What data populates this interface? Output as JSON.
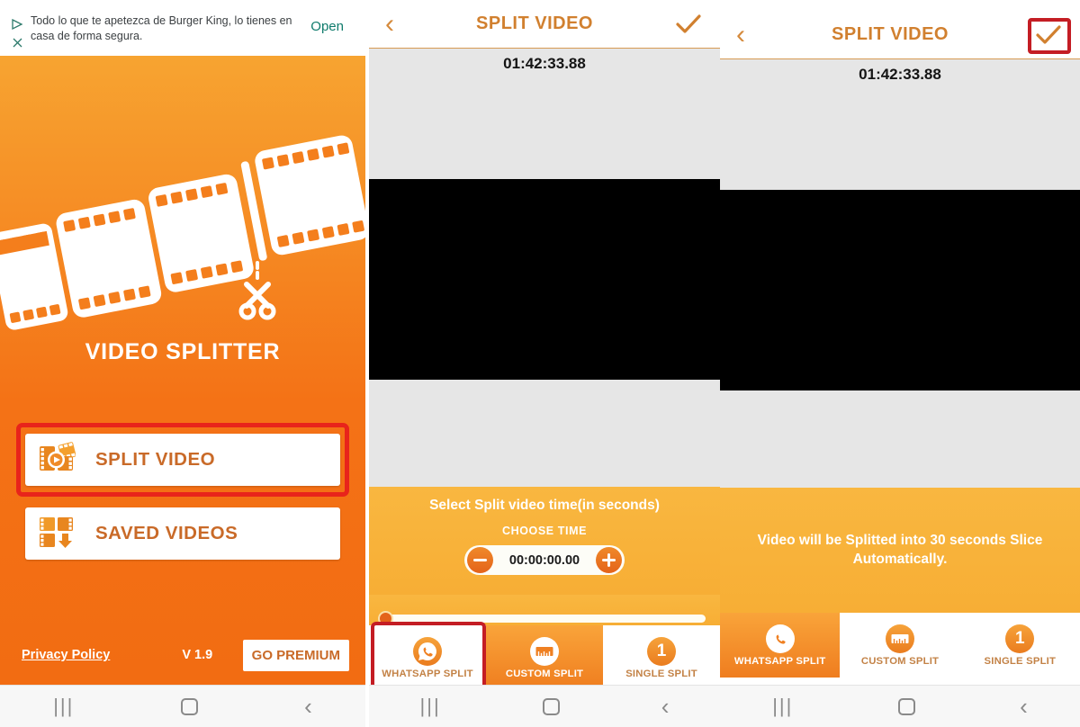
{
  "colors": {
    "orange_primary": "#f47216",
    "orange_light": "#f9b740",
    "orange_text": "#c96a28",
    "highlight_red": "#e8241b",
    "highlight_red_dark": "#c41d24",
    "white": "#ffffff",
    "video_bg": "#e6e6e6",
    "video_black": "#000000"
  },
  "screen1": {
    "ad": {
      "text": "Todo lo que te apetezca de Burger King, lo tienes en casa de forma segura.",
      "cta": "Open",
      "play_icon": "ad-choices-icon",
      "close_icon": "close-icon"
    },
    "logo_icon": "film-strip-scissors-logo",
    "app_title": "VIDEO SPLITTER",
    "buttons": [
      {
        "label": "SPLIT VIDEO",
        "icon": "film-play-icon",
        "highlighted": true
      },
      {
        "label": "SAVED VIDEOS",
        "icon": "film-download-icon",
        "highlighted": false
      }
    ],
    "footer": {
      "privacy": "Privacy Policy",
      "version": "V 1.9",
      "premium": "GO PREMIUM"
    }
  },
  "screen2": {
    "header": {
      "back_icon": "chevron-left-icon",
      "title": "SPLIT VIDEO",
      "confirm_icon": "check-icon",
      "confirm_highlighted": false
    },
    "timecode": "01:42:33.88",
    "controls": {
      "title": "Select Split video time(in seconds)",
      "subtitle": "CHOOSE TIME",
      "time_value": "00:00:00.00",
      "minus_icon": "minus-circle-icon",
      "plus_icon": "plus-circle-icon",
      "slider_value": 0
    },
    "tabs": [
      {
        "label": "WHATSAPP SPLIT",
        "icon": "whatsapp-icon",
        "state": "white",
        "highlighted": true
      },
      {
        "label": "CUSTOM SPLIT",
        "icon": "ruler-icon",
        "state": "orange",
        "highlighted": false
      },
      {
        "label": "SINGLE SPLIT",
        "icon": "number-one-icon",
        "state": "white",
        "highlighted": false
      }
    ]
  },
  "screen3": {
    "header": {
      "back_icon": "chevron-left-icon",
      "title": "SPLIT VIDEO",
      "confirm_icon": "check-icon",
      "confirm_highlighted": true
    },
    "timecode": "01:42:33.88",
    "message": "Video will be Splitted into 30 seconds Slice Automatically.",
    "tabs": [
      {
        "label": "WHATSAPP SPLIT",
        "icon": "whatsapp-icon",
        "state": "orange",
        "highlighted": false
      },
      {
        "label": "CUSTOM SPLIT",
        "icon": "ruler-icon",
        "state": "white",
        "highlighted": false
      },
      {
        "label": "SINGLE SPLIT",
        "icon": "number-one-icon",
        "state": "white",
        "highlighted": false
      }
    ]
  },
  "navbar": {
    "recents_icon": "recents-icon",
    "recents_glyph": "|||",
    "home_icon": "home-icon",
    "back_icon": "back-icon",
    "back_glyph": "‹"
  }
}
